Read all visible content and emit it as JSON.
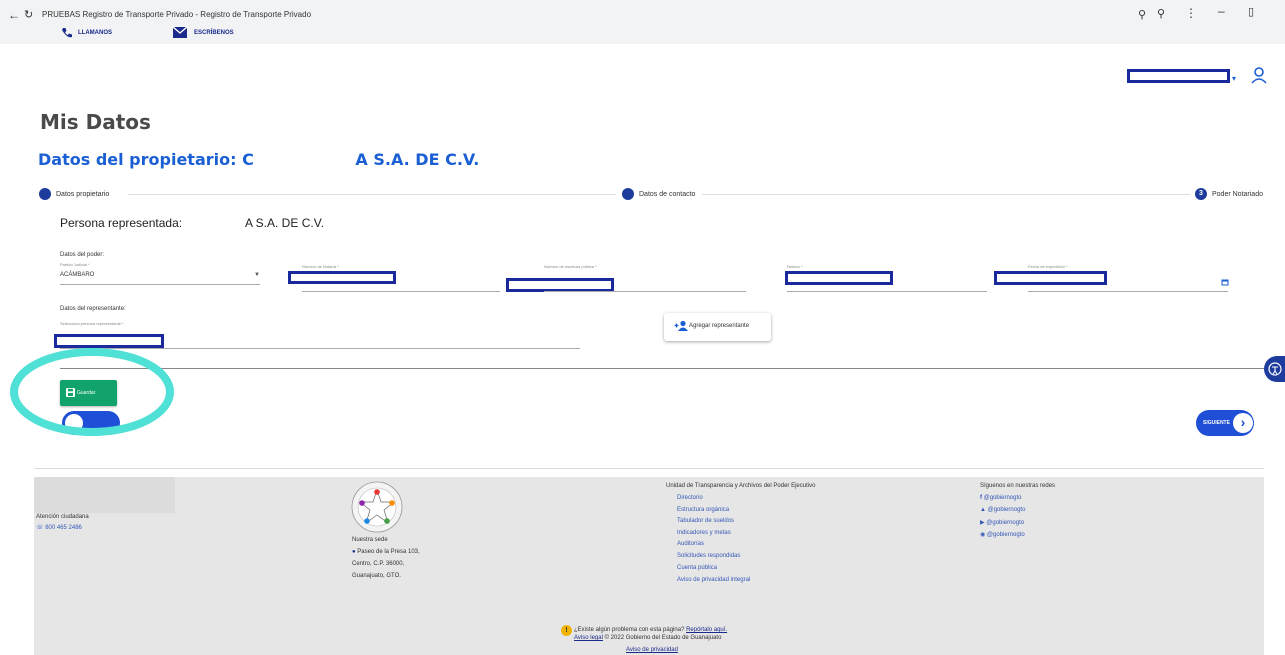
{
  "browser": {
    "title": "PRUEBAS Registro de Transporte Privado - Registro de Transporte Privado"
  },
  "topbar": {
    "call_label": "LLAMANOS",
    "write_label": "ESCRÍBENOS"
  },
  "page": {
    "title": "Mis Datos",
    "subtitle_prefix": "Datos del propietario: C",
    "subtitle_suffix": "A S.A. DE C.V."
  },
  "stepper": {
    "steps": [
      {
        "label": "Datos propietario"
      },
      {
        "label": "Datos de contacto"
      },
      {
        "label": "Poder Notariado",
        "number": "3"
      }
    ]
  },
  "form": {
    "represented_label": "Persona representada:",
    "represented_value": "A S.A. DE C.V.",
    "poder_section": "Datos del poder:",
    "partido_label": "Partido Judicial *",
    "partido_value": "ACÁMBARO",
    "notaria_label": "Número de Notaría *",
    "escritura_label": "Número de escritura pública *",
    "notario_label": "Notario *",
    "fecha_label": "Fecha de expedición *",
    "representante_section": "Datos del representante:",
    "select_rep_label": "Selecciona persona representante *",
    "add_rep_button": "Agregar representante",
    "save_button": "Guardar",
    "next_button": "SIGUIENTE"
  },
  "footer": {
    "attention_label": "Atención ciudadana",
    "phone": "800 465 2486",
    "sede_label": "Nuestra sede",
    "address_line1": "Paseo de la Presa 103,",
    "address_line2": "Centro, C.P. 36000,",
    "address_line3": "Guanajuato, GTO.",
    "transparency_title": "Unidad de Transparencia y Archivos del Poder Ejecutivo",
    "links": [
      "Directorio",
      "Estructura orgánica",
      "Tabulador de sueldos",
      "Indicadores y metas",
      "Auditorías",
      "Solicitudes respondidas",
      "Cuenta pública",
      "Aviso de privacidad integral"
    ],
    "social_title": "Síguenos en nuestras redes",
    "social": [
      "@gobiernogto",
      "@gobiernogto",
      "@gobiernogto",
      "@gobiernogto"
    ],
    "problem_text": "¿Existe algún problema con esta página?",
    "report_link": "Repórtalo aquí.",
    "legal_link": "Aviso legal",
    "copyright": "© 2022 Gobierno del Estado de Guanajuato",
    "privacy_link": "Aviso de privacidad"
  },
  "colors": {
    "primary": "#1e3c9e",
    "accent_blue": "#1a5fd4",
    "save_green": "#11a36b",
    "highlight_teal": "#4fe0d6"
  }
}
